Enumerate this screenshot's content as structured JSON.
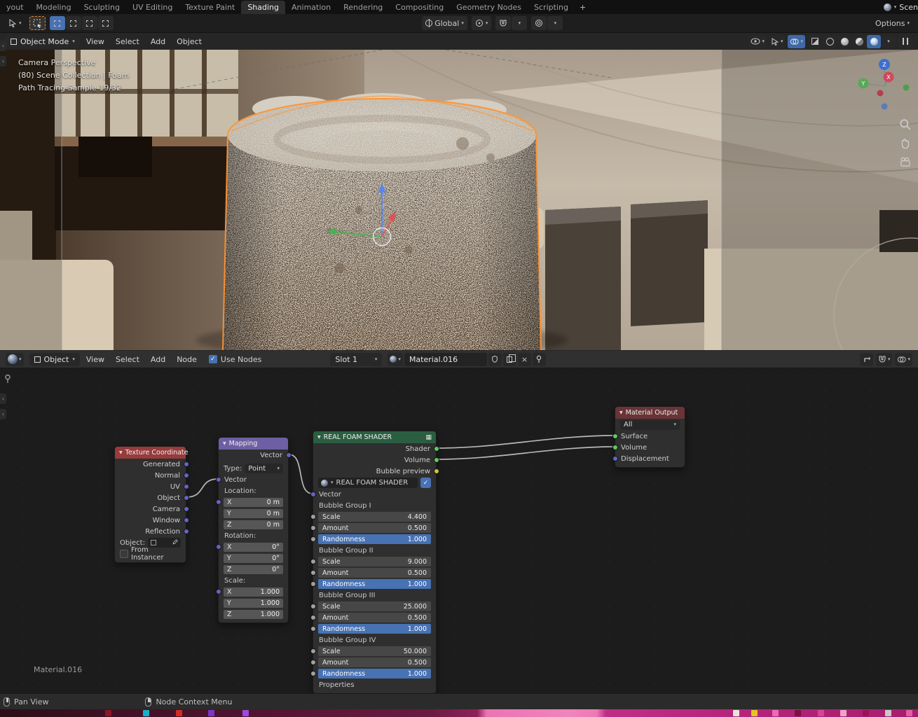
{
  "topbar": {
    "tabs": [
      "yout",
      "Modeling",
      "Sculpting",
      "UV Editing",
      "Texture Paint",
      "Shading",
      "Animation",
      "Rendering",
      "Compositing",
      "Geometry Nodes",
      "Scripting"
    ],
    "add_tab_label": "+",
    "scene_label": "Scen"
  },
  "toolbar": {
    "transform_orientation": "Global",
    "options_label": "Options"
  },
  "viewport": {
    "mode": "Object Mode",
    "menus": [
      "View",
      "Select",
      "Add",
      "Object"
    ],
    "overlay_line1": "Camera Perspective",
    "overlay_line2": "(80) Scene Collection | Foam",
    "overlay_line3": "Path Tracing Sample 19/32",
    "axis_z": "Z",
    "axis_x": "X",
    "axis_y": "Y"
  },
  "shader_editor": {
    "shader_type": "Object",
    "menus": [
      "View",
      "Select",
      "Add",
      "Node"
    ],
    "use_nodes_label": "Use Nodes",
    "slot_label": "Slot 1",
    "material_name": "Material.016",
    "footer_label": "Material.016"
  },
  "nodes": {
    "texture_coordinate": {
      "title": "Texture Coordinate",
      "outputs": [
        "Generated",
        "Normal",
        "UV",
        "Object",
        "Camera",
        "Window",
        "Reflection"
      ],
      "object_label": "Object:",
      "from_instancer_label": "From Instancer"
    },
    "mapping": {
      "title": "Mapping",
      "output_label": "Vector",
      "type_label": "Type:",
      "type_value": "Point",
      "input_label": "Vector",
      "axis_x": "X",
      "axis_y": "Y",
      "axis_z": "Z",
      "location": {
        "label": "Location:",
        "x": "0 m",
        "y": "0 m",
        "z": "0 m"
      },
      "rotation": {
        "label": "Rotation:",
        "x": "0°",
        "y": "0°",
        "z": "0°"
      },
      "scale": {
        "label": "Scale:",
        "x": "1.000",
        "y": "1.000",
        "z": "1.000"
      }
    },
    "foam_shader": {
      "title": "REAL FOAM SHADER",
      "outputs": [
        "Shader",
        "Volume",
        "Bubble preview"
      ],
      "group_name": "REAL FOAM SHADER",
      "input_label": "Vector",
      "scale_label": "Scale",
      "amount_label": "Amount",
      "randomness_label": "Randomness",
      "groups": [
        {
          "label": "Bubble Group I",
          "scale": "4.400",
          "amount": "0.500",
          "randomness": "1.000"
        },
        {
          "label": "Bubble Group II",
          "scale": "9.000",
          "amount": "0.500",
          "randomness": "1.000"
        },
        {
          "label": "Bubble Group III",
          "scale": "25.000",
          "amount": "0.500",
          "randomness": "1.000"
        },
        {
          "label": "Bubble Group IV",
          "scale": "50.000",
          "amount": "0.500",
          "randomness": "1.000"
        }
      ],
      "properties_label": "Properties"
    },
    "material_output": {
      "title": "Material Output",
      "target_value": "All",
      "inputs": [
        "Surface",
        "Volume",
        "Displacement"
      ]
    }
  },
  "statusbar": {
    "pan_view": "Pan View",
    "node_context_menu": "Node Context Menu"
  },
  "icons": {
    "chevron_down": "▾",
    "collapse_triangle": "▼",
    "checkmark": "✓",
    "close": "×",
    "node_group": "▦",
    "side_tab": "‹"
  },
  "colors": {
    "accent_blue": "#4772b3",
    "selection_orange": "#ff9430",
    "socket_vector": "#6363c7",
    "socket_shader": "#63c763",
    "socket_color": "#c8c832",
    "socket_value": "#a1a1a1",
    "header_texture_coordinate_style": "background:#973b3b",
    "header_mapping_style": "background:#6e5fa4",
    "header_group_style": "background:#2b5e41",
    "header_material_output_style": "background:#6a3436"
  },
  "taskbar": {
    "background_style": "background:linear-gradient(90deg,#2c0e18 0%,#3e1124 12%,#541432 30%,#6b1a42 47%,#8e2158 52%,#ea74b2 53%,#f083bc 62%,#ec7ab6 65%,#c02d85 66%,#b32478 82%,#a61e6d 100%)",
    "items": [
      {
        "style": "left:150px;background:#8c1626"
      },
      {
        "style": "left:204px;background:#14b2c8"
      },
      {
        "style": "left:251px;background:#d32b25"
      },
      {
        "style": "left:297px;background:#7b36c9"
      },
      {
        "style": "left:346px;background:#9b49e0"
      },
      {
        "style": "left:1046px;background:#e8e4da"
      },
      {
        "style": "left:1072px;background:#e2c328"
      },
      {
        "style": "left:1102px;background:#e86cb4"
      },
      {
        "style": "left:1134px;background:#7a1240"
      },
      {
        "style": "left:1167px;background:#d8439a"
      },
      {
        "style": "left:1199px;background:#f0a2cc"
      },
      {
        "style": "left:1231px;background:#9c1258"
      },
      {
        "style": "left:1263px;background:#c9c9c9"
      },
      {
        "style": "left:1293px;background:#e060a2"
      }
    ]
  }
}
